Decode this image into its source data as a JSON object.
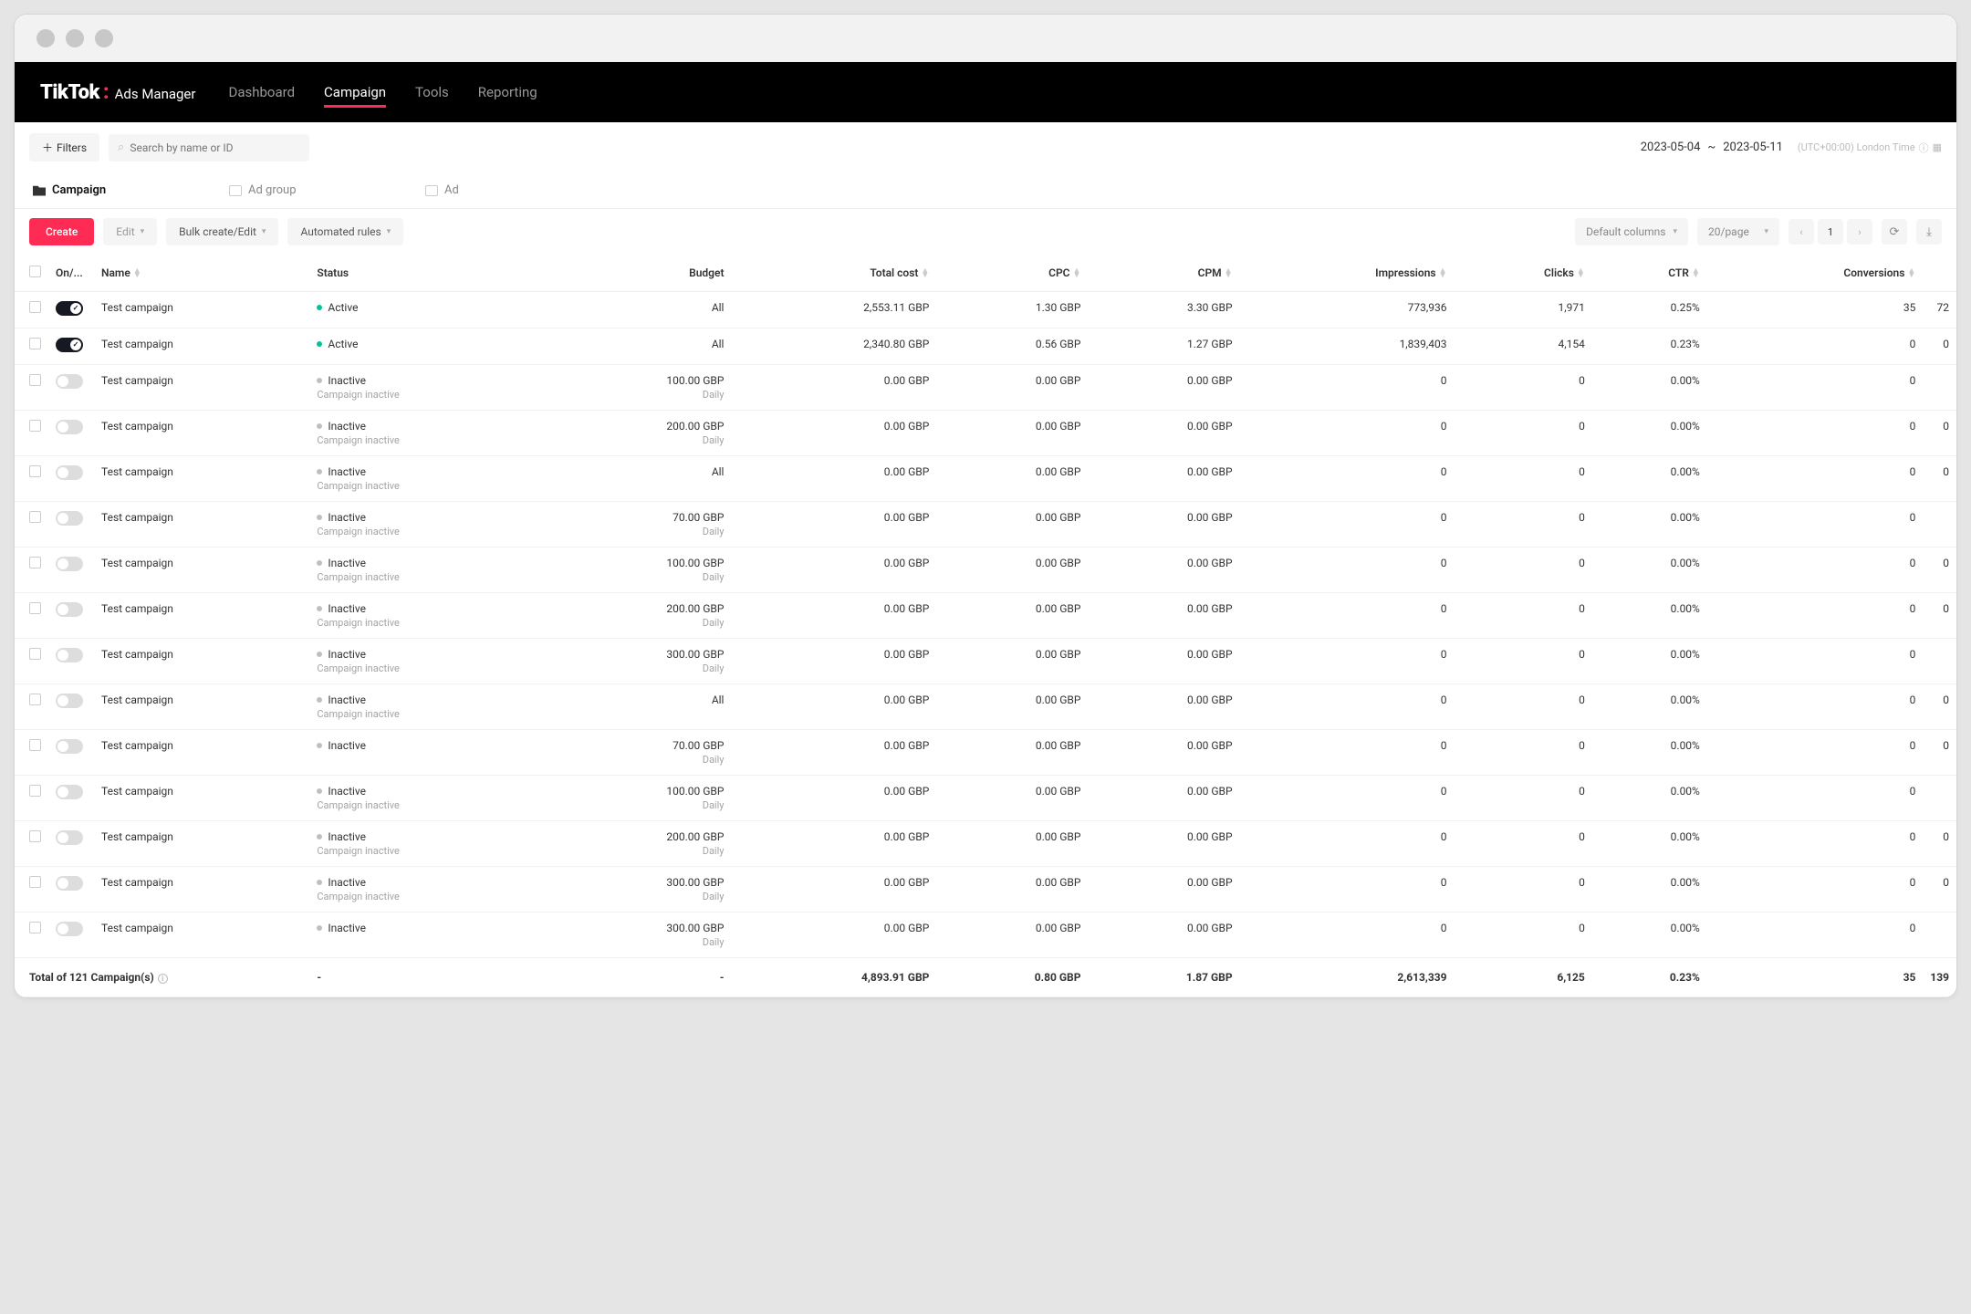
{
  "logo": {
    "main": "TikTok",
    "sub": "Ads Manager"
  },
  "nav": {
    "items": [
      "Dashboard",
      "Campaign",
      "Tools",
      "Reporting"
    ],
    "active": 1
  },
  "toolbar1": {
    "filters": "Filters",
    "search_placeholder": "Search by name or ID",
    "date_from": "2023-05-04",
    "date_to": "2023-05-11",
    "tz": "(UTC+00:00) London Time"
  },
  "tabs": {
    "items": [
      "Campaign",
      "Ad group",
      "Ad"
    ],
    "active": 0
  },
  "toolbar2": {
    "create": "Create",
    "edit": "Edit",
    "bulk": "Bulk create/Edit",
    "auto": "Automated rules",
    "cols": "Default columns",
    "pagesize": "20/page",
    "page": "1"
  },
  "headers": {
    "onoff": "On/...",
    "name": "Name",
    "status": "Status",
    "budget": "Budget",
    "total_cost": "Total cost",
    "cpc": "CPC",
    "cpm": "CPM",
    "impressions": "Impressions",
    "clicks": "Clicks",
    "ctr": "CTR",
    "conversions": "Conversions"
  },
  "rows": [
    {
      "on": true,
      "name": "Test campaign",
      "status": "Active",
      "sub": "",
      "budget": "All",
      "bsub": "",
      "total_cost": "2,553.11 GBP",
      "cpc": "1.30 GBP",
      "cpm": "3.30 GBP",
      "impressions": "773,936",
      "clicks": "1,971",
      "ctr": "0.25%",
      "conversions": "35",
      "trail": "72"
    },
    {
      "on": true,
      "name": "Test campaign",
      "status": "Active",
      "sub": "",
      "budget": "All",
      "bsub": "",
      "total_cost": "2,340.80 GBP",
      "cpc": "0.56 GBP",
      "cpm": "1.27 GBP",
      "impressions": "1,839,403",
      "clicks": "4,154",
      "ctr": "0.23%",
      "conversions": "0",
      "trail": "0"
    },
    {
      "on": false,
      "name": "Test campaign",
      "status": "Inactive",
      "sub": "Campaign inactive",
      "budget": "100.00 GBP",
      "bsub": "Daily",
      "total_cost": "0.00 GBP",
      "cpc": "0.00 GBP",
      "cpm": "0.00 GBP",
      "impressions": "0",
      "clicks": "0",
      "ctr": "0.00%",
      "conversions": "0",
      "trail": ""
    },
    {
      "on": false,
      "name": "Test campaign",
      "status": "Inactive",
      "sub": "Campaign inactive",
      "budget": "200.00 GBP",
      "bsub": "Daily",
      "total_cost": "0.00 GBP",
      "cpc": "0.00 GBP",
      "cpm": "0.00 GBP",
      "impressions": "0",
      "clicks": "0",
      "ctr": "0.00%",
      "conversions": "0",
      "trail": "0"
    },
    {
      "on": false,
      "name": "Test campaign",
      "status": "Inactive",
      "sub": "Campaign inactive",
      "budget": "All",
      "bsub": "",
      "total_cost": "0.00 GBP",
      "cpc": "0.00 GBP",
      "cpm": "0.00 GBP",
      "impressions": "0",
      "clicks": "0",
      "ctr": "0.00%",
      "conversions": "0",
      "trail": "0"
    },
    {
      "on": false,
      "name": "Test campaign",
      "status": "Inactive",
      "sub": "Campaign inactive",
      "budget": "70.00 GBP",
      "bsub": "Daily",
      "total_cost": "0.00 GBP",
      "cpc": "0.00 GBP",
      "cpm": "0.00 GBP",
      "impressions": "0",
      "clicks": "0",
      "ctr": "0.00%",
      "conversions": "0",
      "trail": ""
    },
    {
      "on": false,
      "name": "Test campaign",
      "status": "Inactive",
      "sub": "Campaign inactive",
      "budget": "100.00 GBP",
      "bsub": "Daily",
      "total_cost": "0.00 GBP",
      "cpc": "0.00 GBP",
      "cpm": "0.00 GBP",
      "impressions": "0",
      "clicks": "0",
      "ctr": "0.00%",
      "conversions": "0",
      "trail": "0"
    },
    {
      "on": false,
      "name": "Test campaign",
      "status": "Inactive",
      "sub": "Campaign inactive",
      "budget": "200.00 GBP",
      "bsub": "Daily",
      "total_cost": "0.00 GBP",
      "cpc": "0.00 GBP",
      "cpm": "0.00 GBP",
      "impressions": "0",
      "clicks": "0",
      "ctr": "0.00%",
      "conversions": "0",
      "trail": "0"
    },
    {
      "on": false,
      "name": "Test campaign",
      "status": "Inactive",
      "sub": "Campaign inactive",
      "budget": "300.00 GBP",
      "bsub": "Daily",
      "total_cost": "0.00 GBP",
      "cpc": "0.00 GBP",
      "cpm": "0.00 GBP",
      "impressions": "0",
      "clicks": "0",
      "ctr": "0.00%",
      "conversions": "0",
      "trail": ""
    },
    {
      "on": false,
      "name": "Test campaign",
      "status": "Inactive",
      "sub": "Campaign inactive",
      "budget": "All",
      "bsub": "",
      "total_cost": "0.00 GBP",
      "cpc": "0.00 GBP",
      "cpm": "0.00 GBP",
      "impressions": "0",
      "clicks": "0",
      "ctr": "0.00%",
      "conversions": "0",
      "trail": "0"
    },
    {
      "on": false,
      "name": "Test campaign",
      "status": "Inactive",
      "sub": "",
      "budget": "70.00 GBP",
      "bsub": "Daily",
      "total_cost": "0.00 GBP",
      "cpc": "0.00 GBP",
      "cpm": "0.00 GBP",
      "impressions": "0",
      "clicks": "0",
      "ctr": "0.00%",
      "conversions": "0",
      "trail": "0"
    },
    {
      "on": false,
      "name": "Test campaign",
      "status": "Inactive",
      "sub": "Campaign inactive",
      "budget": "100.00 GBP",
      "bsub": "Daily",
      "total_cost": "0.00 GBP",
      "cpc": "0.00 GBP",
      "cpm": "0.00 GBP",
      "impressions": "0",
      "clicks": "0",
      "ctr": "0.00%",
      "conversions": "0",
      "trail": ""
    },
    {
      "on": false,
      "name": "Test campaign",
      "status": "Inactive",
      "sub": "Campaign inactive",
      "budget": "200.00 GBP",
      "bsub": "Daily",
      "total_cost": "0.00 GBP",
      "cpc": "0.00 GBP",
      "cpm": "0.00 GBP",
      "impressions": "0",
      "clicks": "0",
      "ctr": "0.00%",
      "conversions": "0",
      "trail": "0"
    },
    {
      "on": false,
      "name": "Test campaign",
      "status": "Inactive",
      "sub": "Campaign inactive",
      "budget": "300.00 GBP",
      "bsub": "Daily",
      "total_cost": "0.00 GBP",
      "cpc": "0.00 GBP",
      "cpm": "0.00 GBP",
      "impressions": "0",
      "clicks": "0",
      "ctr": "0.00%",
      "conversions": "0",
      "trail": "0"
    },
    {
      "on": false,
      "name": "Test campaign",
      "status": "Inactive",
      "sub": "",
      "budget": "300.00 GBP",
      "bsub": "Daily",
      "total_cost": "0.00 GBP",
      "cpc": "0.00 GBP",
      "cpm": "0.00 GBP",
      "impressions": "0",
      "clicks": "0",
      "ctr": "0.00%",
      "conversions": "0",
      "trail": ""
    }
  ],
  "footer": {
    "label": "Total of 121 Campaign(s)",
    "total_cost": "4,893.91 GBP",
    "cpc": "0.80 GBP",
    "cpm": "1.87 GBP",
    "impressions": "2,613,339",
    "clicks": "6,125",
    "ctr": "0.23%",
    "conversions": "35",
    "trail": "139"
  }
}
